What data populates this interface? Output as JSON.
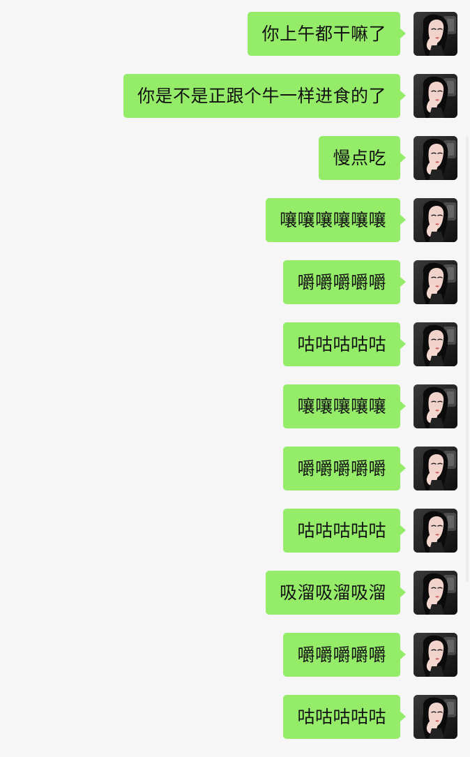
{
  "messages": [
    {
      "text": "你上午都干嘛了",
      "avatar": "user-avatar"
    },
    {
      "text": "你是不是正跟个牛一样进食的了",
      "avatar": "user-avatar"
    },
    {
      "text": "慢点吃",
      "avatar": "user-avatar"
    },
    {
      "text": "嚷嚷嚷嚷嚷嚷",
      "avatar": "user-avatar"
    },
    {
      "text": "嚼嚼嚼嚼嚼",
      "avatar": "user-avatar"
    },
    {
      "text": "咕咕咕咕咕",
      "avatar": "user-avatar"
    },
    {
      "text": "嚷嚷嚷嚷嚷",
      "avatar": "user-avatar"
    },
    {
      "text": "嚼嚼嚼嚼嚼",
      "avatar": "user-avatar"
    },
    {
      "text": "咕咕咕咕咕",
      "avatar": "user-avatar"
    },
    {
      "text": "吸溜吸溜吸溜",
      "avatar": "user-avatar"
    },
    {
      "text": "嚼嚼嚼嚼嚼",
      "avatar": "user-avatar"
    },
    {
      "text": "咕咕咕咕咕",
      "avatar": "user-avatar"
    }
  ],
  "colors": {
    "bubble": "#95ec69",
    "background": "#f6f6f6",
    "text": "#111111"
  }
}
